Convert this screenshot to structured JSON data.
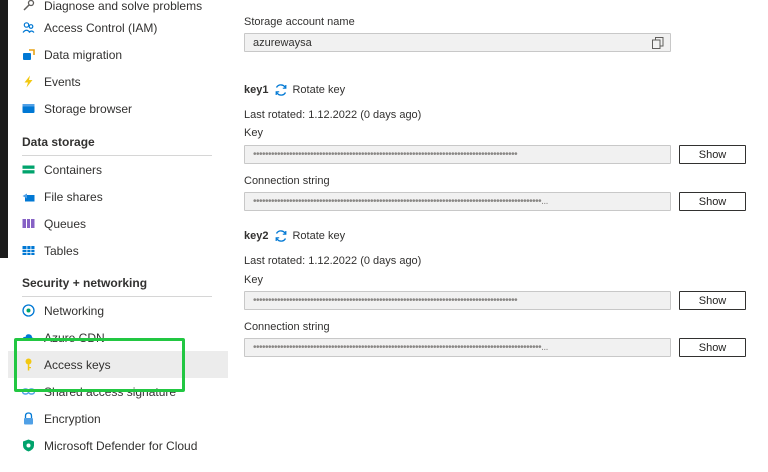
{
  "sidebar": {
    "items_top": [
      {
        "label": "Diagnose and solve problems",
        "icon": "wrench-icon"
      },
      {
        "label": "Access Control (IAM)",
        "icon": "people-icon"
      },
      {
        "label": "Data migration",
        "icon": "data-migration-icon"
      },
      {
        "label": "Events",
        "icon": "lightning-icon"
      },
      {
        "label": "Storage browser",
        "icon": "storage-browser-icon"
      }
    ],
    "section_data_storage": "Data storage",
    "items_data": [
      {
        "label": "Containers",
        "icon": "containers-icon"
      },
      {
        "label": "File shares",
        "icon": "file-shares-icon"
      },
      {
        "label": "Queues",
        "icon": "queues-icon"
      },
      {
        "label": "Tables",
        "icon": "tables-icon"
      }
    ],
    "section_security": "Security + networking",
    "items_security": [
      {
        "label": "Networking",
        "icon": "networking-icon"
      },
      {
        "label": "Azure CDN",
        "icon": "cloud-icon"
      },
      {
        "label": "Access keys",
        "icon": "key-icon"
      },
      {
        "label": "Shared access signature",
        "icon": "link-icon"
      },
      {
        "label": "Encryption",
        "icon": "lock-icon"
      },
      {
        "label": "Microsoft Defender for Cloud",
        "icon": "shield-icon"
      }
    ]
  },
  "main": {
    "storage_account_label": "Storage account name",
    "storage_account_value": "azurewaysa",
    "rotate_key_label": "Rotate key",
    "key_label": "Key",
    "connection_string_label": "Connection string",
    "show_label": "Show",
    "key1": {
      "name": "key1",
      "last_rotated": "Last rotated: 1.12.2022 (0 days ago)",
      "key_mask": "••••••••••••••••••••••••••••••••••••••••••••••••••••••••••••••••••••••••••••••••••••••••",
      "conn_mask": "••••••••••••••••••••••••••••••••••••••••••••••••••••••••••••••••••••••••••••••••••••••••••••••••..."
    },
    "key2": {
      "name": "key2",
      "last_rotated": "Last rotated: 1.12.2022 (0 days ago)",
      "key_mask": "••••••••••••••••••••••••••••••••••••••••••••••••••••••••••••••••••••••••••••••••••••••••",
      "conn_mask": "••••••••••••••••••••••••••••••••••••••••••••••••••••••••••••••••••••••••••••••••••••••••••••••••..."
    }
  },
  "colors": {
    "highlight": "#22c742",
    "accent": "#0078d4",
    "active_bg": "#ececec"
  }
}
